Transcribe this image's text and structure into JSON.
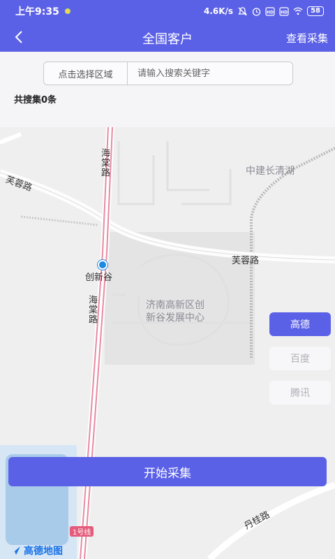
{
  "status_bar": {
    "time": "上午9:35",
    "net_speed": "4.6K/s",
    "battery": "58",
    "icons": [
      "mute-icon",
      "alarm-icon",
      "hd-icon",
      "hd-icon",
      "wifi-icon",
      "battery-icon"
    ]
  },
  "nav": {
    "title": "全国客户",
    "action": "查看采集",
    "back_icon": "chevron-left-icon"
  },
  "search": {
    "region_label": "点击选择区域",
    "placeholder": "请输入搜索关键字",
    "value": ""
  },
  "result_count": "共搜集0条",
  "map": {
    "labels": {
      "haitang_road_top": "海棠路",
      "furong_road_left": "芙蓉路",
      "zhongjian": "中建长清湖",
      "furong_road_right": "芙蓉路",
      "chuangxingu": "创新谷",
      "haitang_road_mid": "海棠路",
      "district_line1": "济南高新区创",
      "district_line2": "新谷发展中心",
      "dangui_road": "丹桂路",
      "line1": "1号线"
    },
    "logo_text": "高德地图"
  },
  "providers": {
    "items": [
      "高德",
      "百度",
      "腾讯"
    ],
    "active": "高德"
  },
  "start_button": "开始采集",
  "colors": {
    "primary": "#5b61e6",
    "road_pink": "#e78aa2",
    "map_bg": "#efefef"
  }
}
